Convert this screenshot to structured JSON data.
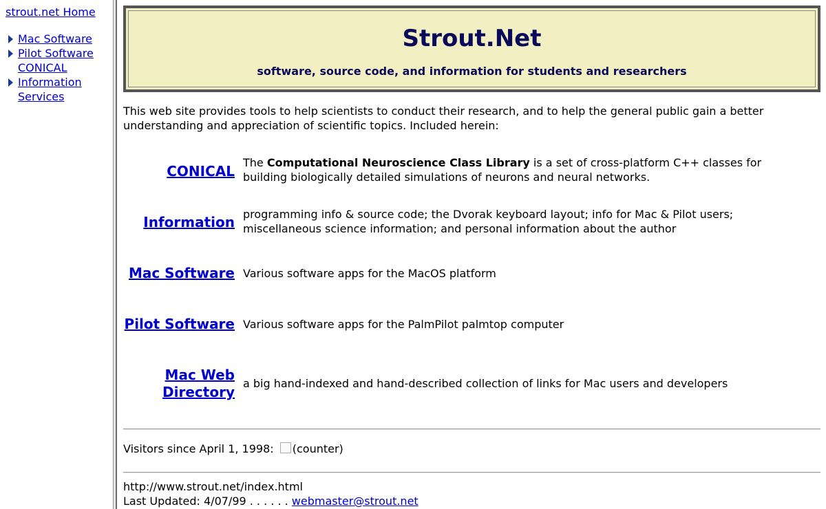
{
  "sidebar": {
    "home_link": "strout.net Home",
    "items": [
      {
        "label": "Mac Software"
      },
      {
        "label": "Pilot Software"
      },
      {
        "label": "CONICAL"
      },
      {
        "label": "Information Services"
      }
    ]
  },
  "banner": {
    "title": "Strout.Net",
    "tagline": "software, source code, and information for students and researchers"
  },
  "intro": "This web site provides tools to help scientists to conduct their research, and to help the general public gain a better understanding and appreciation of scientific topics. Included herein:",
  "entries": [
    {
      "label": "CONICAL",
      "desc_pre": "The ",
      "desc_bold": "Computational Neuroscience Class Library",
      "desc_post": " is a set of cross-platform C++ classes for building biologically detailed simulations of neurons and neural networks."
    },
    {
      "label": "Information",
      "desc": "programming info & source code; the Dvorak keyboard layout; info for Mac & Pilot users; miscellaneous science information; and personal information about the author"
    },
    {
      "label": "Mac Software",
      "desc": "Various software apps for the MacOS platform"
    },
    {
      "label": "Pilot Software",
      "desc": "Various software apps for the PalmPilot palmtop computer"
    },
    {
      "label": "Mac Web Directory",
      "desc": "a big hand-indexed and hand-described collection of links for Mac users and developers"
    }
  ],
  "visitors": {
    "text": "Visitors since April 1, 1998: ",
    "counter_alt": "(counter)"
  },
  "footer": {
    "url": "http://www.strout.net/index.html",
    "updated": "Last Updated: 4/07/99 . . . . . . ",
    "email": "webmaster@strout.net"
  },
  "icons": {
    "bullet": "triangle-bullet-icon"
  },
  "colors": {
    "link": "#0000cc",
    "banner_bg": "#f2efc2",
    "title": "#0a0a5a"
  }
}
